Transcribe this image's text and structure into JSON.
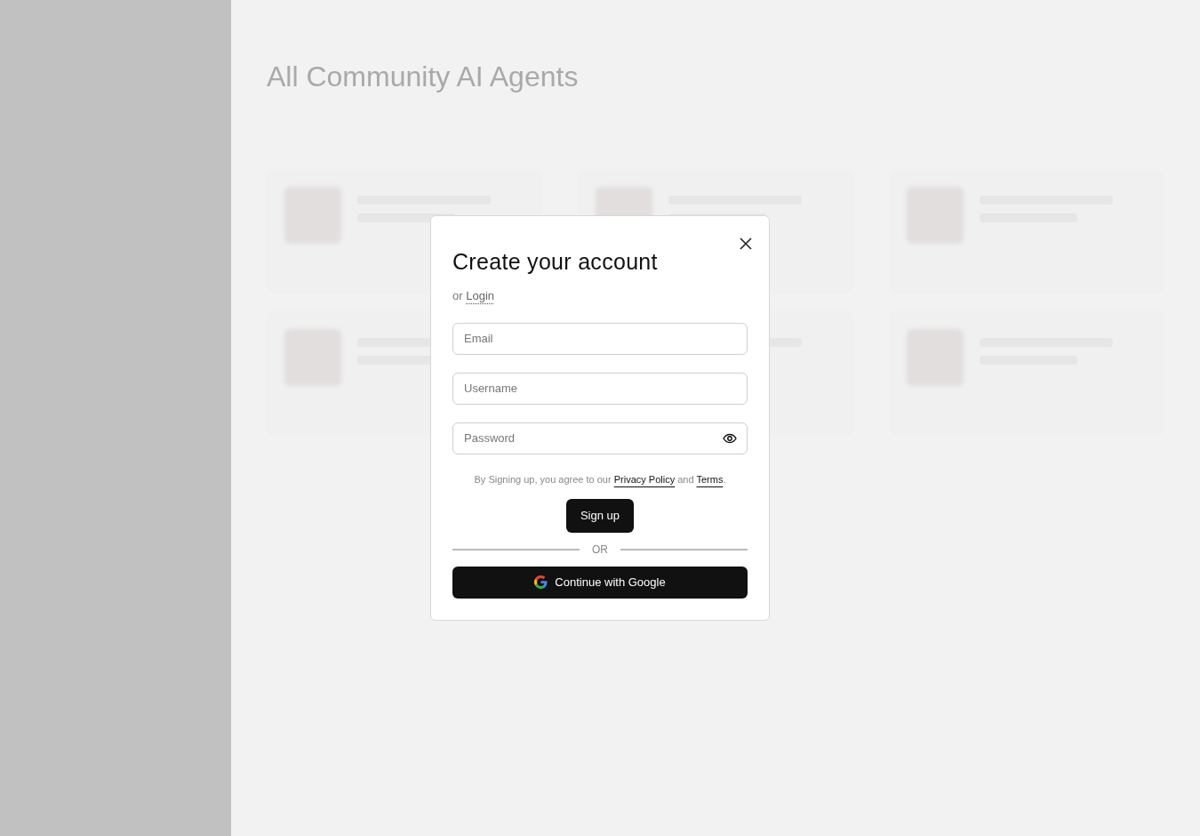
{
  "background": {
    "heading": "All Community AI Agents"
  },
  "modal": {
    "title": "Create your account",
    "login_prompt": {
      "prefix": "or",
      "link": "Login"
    },
    "fields": [
      {
        "kind": "text",
        "placeholder": "Email"
      },
      {
        "kind": "text",
        "placeholder": "Username"
      },
      {
        "kind": "password",
        "placeholder": "Password"
      }
    ],
    "terms": {
      "prefix": "By Signing up, you agree to our",
      "privacy": "Privacy Policy",
      "joiner": "and",
      "terms": "Terms",
      "suffix": "."
    },
    "submit": "Sign up",
    "divider": "OR",
    "google": "Continue with Google"
  }
}
